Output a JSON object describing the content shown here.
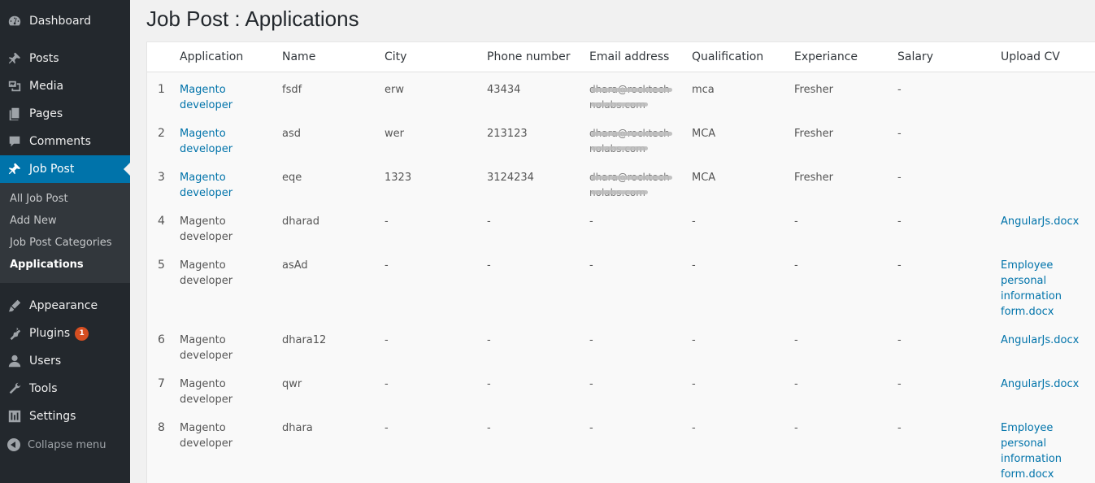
{
  "sidebar": {
    "items": [
      {
        "label": "Dashboard",
        "icon": "dashboard-icon"
      },
      {
        "label": "Posts",
        "icon": "pin-icon"
      },
      {
        "label": "Media",
        "icon": "media-icon"
      },
      {
        "label": "Pages",
        "icon": "pages-icon"
      },
      {
        "label": "Comments",
        "icon": "comments-icon"
      },
      {
        "label": "Job Post",
        "icon": "pin-icon",
        "active": true
      },
      {
        "label": "Appearance",
        "icon": "brush-icon"
      },
      {
        "label": "Plugins",
        "icon": "plugin-icon",
        "badge": "1"
      },
      {
        "label": "Users",
        "icon": "user-icon"
      },
      {
        "label": "Tools",
        "icon": "wrench-icon"
      },
      {
        "label": "Settings",
        "icon": "settings-icon"
      }
    ],
    "submenu": [
      "All Job Post",
      "Add New",
      "Job Post Categories",
      "Applications"
    ],
    "collapse_label": "Collapse menu"
  },
  "page": {
    "title": "Job Post : Applications"
  },
  "table": {
    "headers": [
      "Application",
      "Name",
      "City",
      "Phone number",
      "Email address",
      "Qualification",
      "Experiance",
      "Salary",
      "Upload CV"
    ],
    "rows": [
      {
        "num": "1",
        "application": "Magento developer",
        "application_link": true,
        "name": "fsdf",
        "city": "erw",
        "phone": "43434",
        "email": "dhara@rocktechnolabs.com",
        "qualification": "mca",
        "experience": "Fresher",
        "salary": "-",
        "cv": ""
      },
      {
        "num": "2",
        "application": "Magento developer",
        "application_link": true,
        "name": "asd",
        "city": "wer",
        "phone": "213123",
        "email": "dhara@rocktechnolabs.com",
        "qualification": "MCA",
        "experience": "Fresher",
        "salary": "-",
        "cv": ""
      },
      {
        "num": "3",
        "application": "Magento developer",
        "application_link": true,
        "name": "eqe",
        "city": "1323",
        "phone": "3124234",
        "email": "dhara@rocktechnolabs.com",
        "qualification": "MCA",
        "experience": "Fresher",
        "salary": "-",
        "cv": ""
      },
      {
        "num": "4",
        "application": "Magento developer",
        "application_link": false,
        "name": "dharad",
        "city": "-",
        "phone": "-",
        "email": "-",
        "qualification": "-",
        "experience": "-",
        "salary": "-",
        "cv": "AngularJs.docx"
      },
      {
        "num": "5",
        "application": "Magento developer",
        "application_link": false,
        "name": "asAd",
        "city": "-",
        "phone": "-",
        "email": "-",
        "qualification": "-",
        "experience": "-",
        "salary": "-",
        "cv": "Employee personal information form.docx"
      },
      {
        "num": "6",
        "application": "Magento developer",
        "application_link": false,
        "name": "dhara12",
        "city": "-",
        "phone": "-",
        "email": "-",
        "qualification": "-",
        "experience": "-",
        "salary": "-",
        "cv": "AngularJs.docx"
      },
      {
        "num": "7",
        "application": "Magento developer",
        "application_link": false,
        "name": "qwr",
        "city": "-",
        "phone": "-",
        "email": "-",
        "qualification": "-",
        "experience": "-",
        "salary": "-",
        "cv": "AngularJs.docx"
      },
      {
        "num": "8",
        "application": "Magento developer",
        "application_link": false,
        "name": "dhara",
        "city": "-",
        "phone": "-",
        "email": "-",
        "qualification": "-",
        "experience": "-",
        "salary": "-",
        "cv": "Employee personal information form.docx"
      }
    ]
  },
  "colors": {
    "sidebar_bg": "#23282d",
    "active_bg": "#0073aa",
    "link": "#0073aa",
    "badge": "#d54e21"
  }
}
